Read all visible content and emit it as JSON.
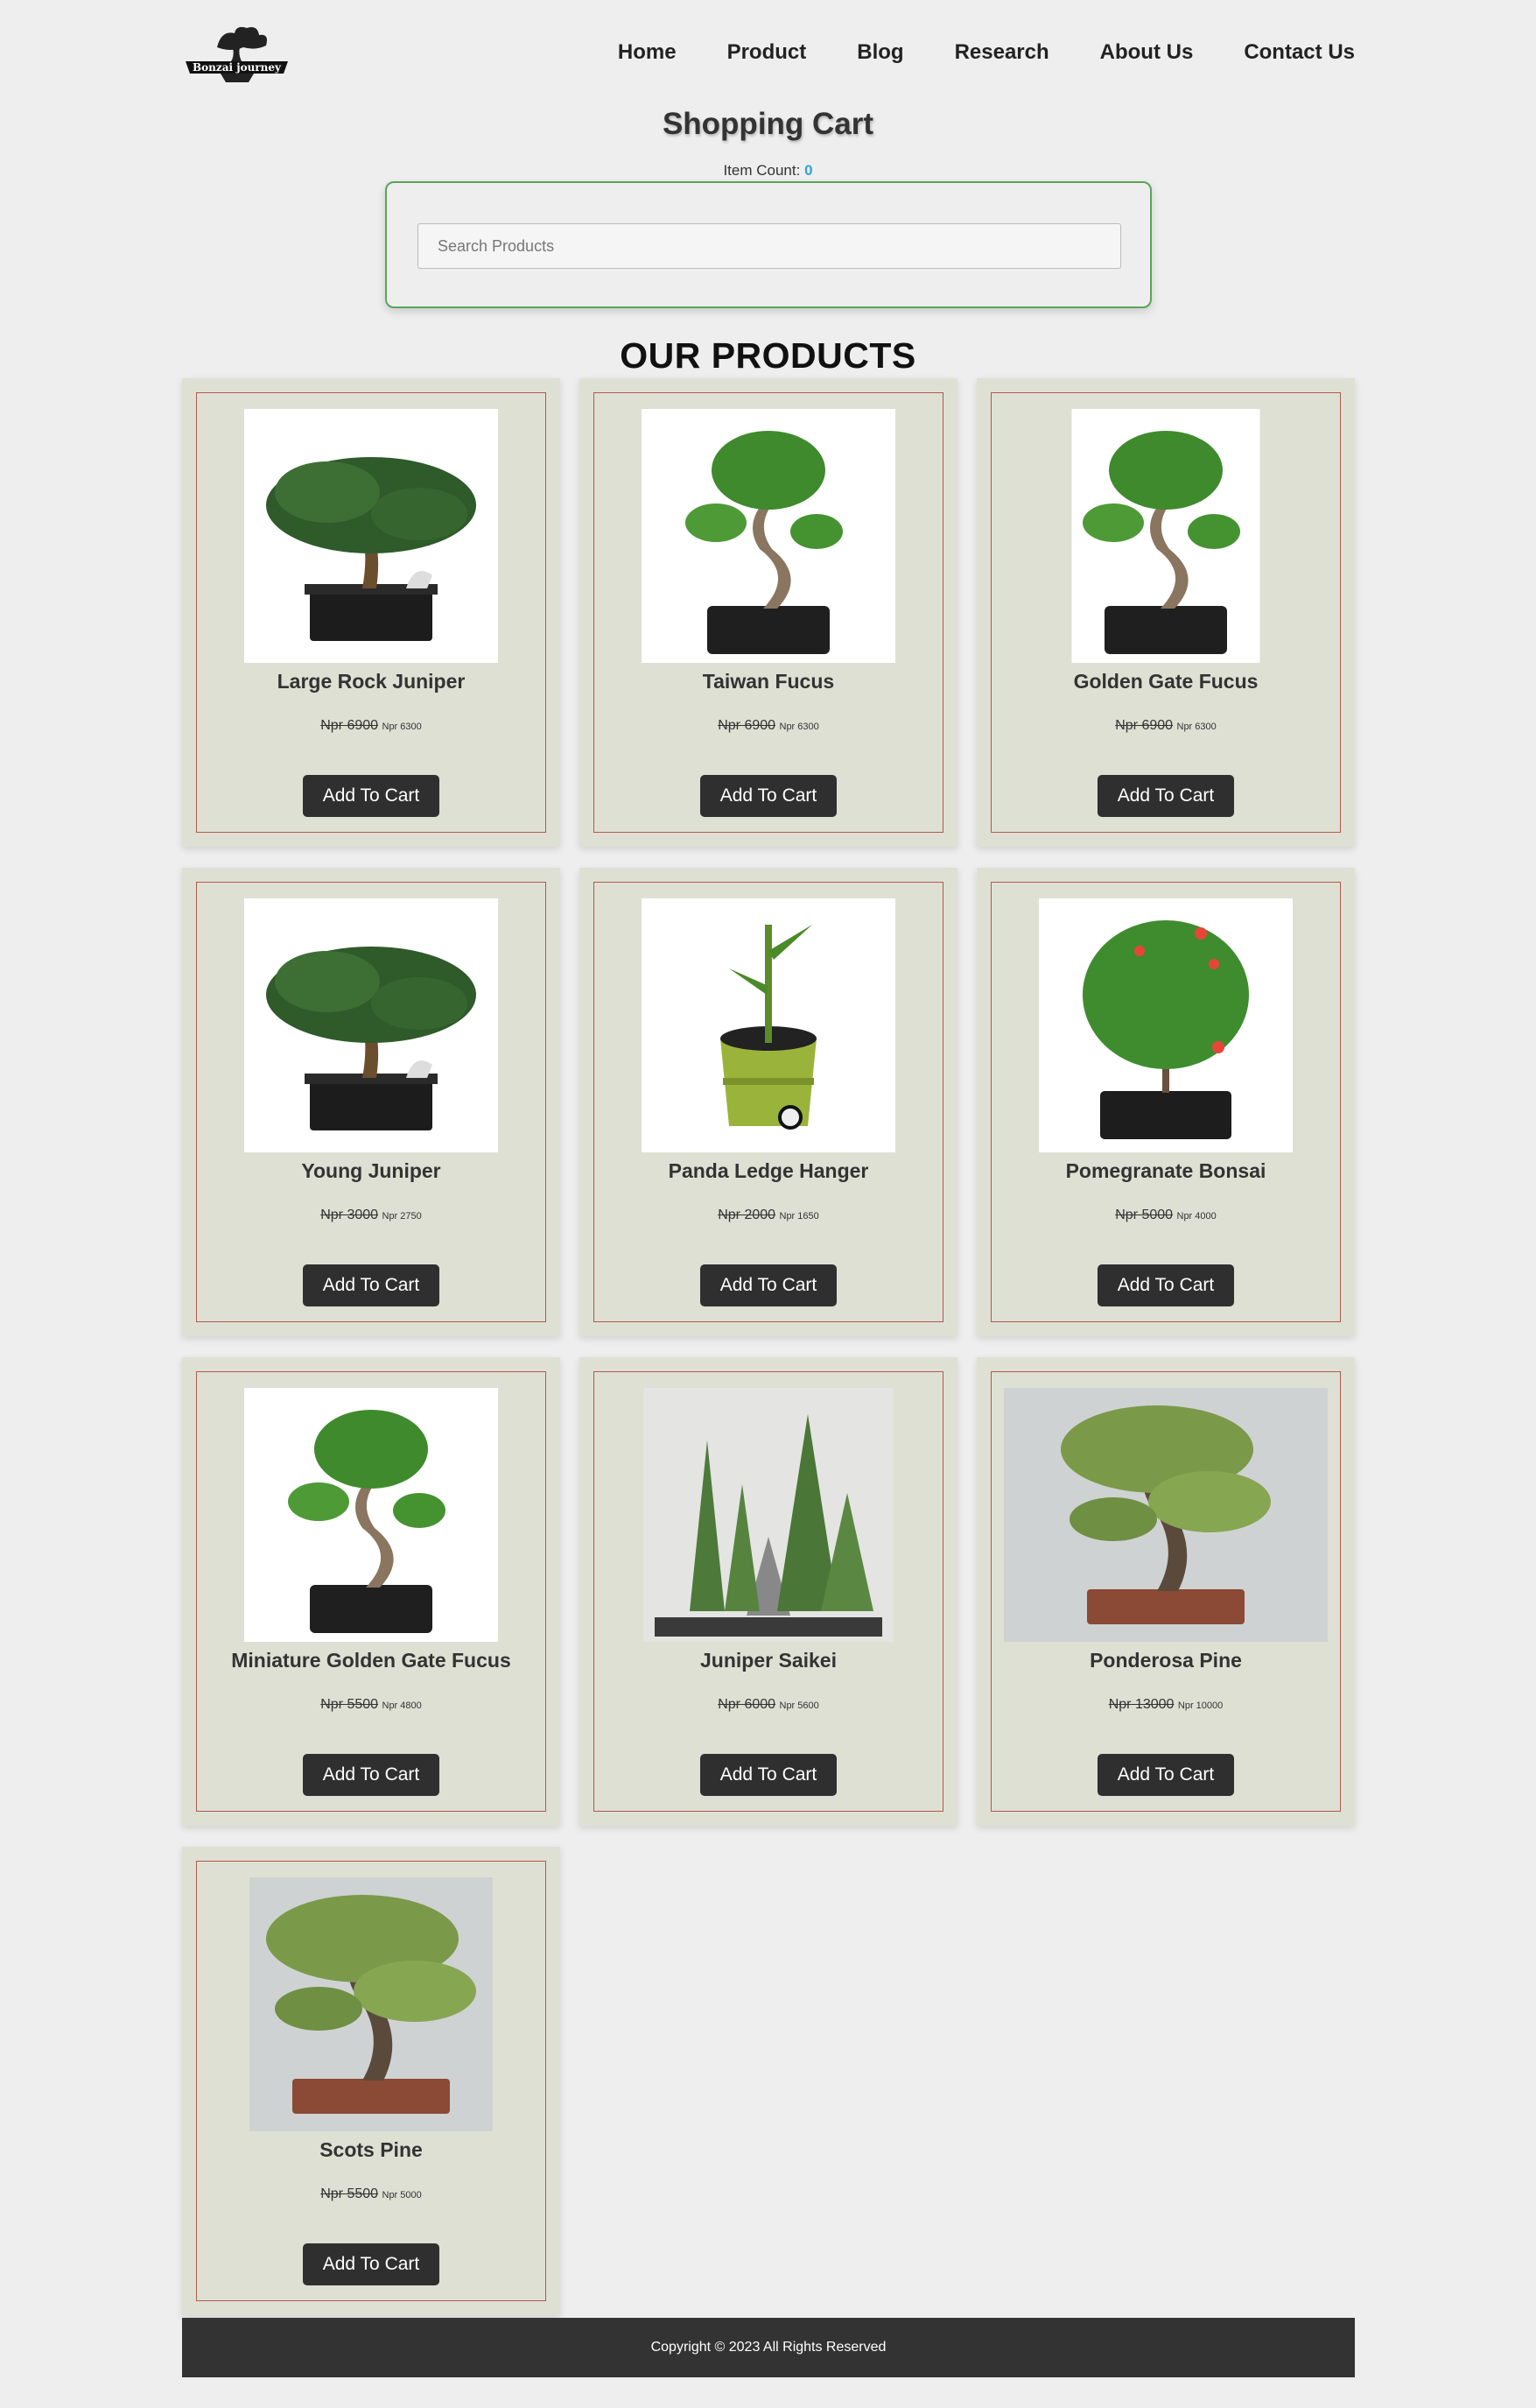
{
  "header": {
    "logo_text": "Bonzai journey",
    "nav": [
      "Home",
      "Product",
      "Blog",
      "Research",
      "About Us",
      "Contact Us"
    ]
  },
  "cart": {
    "title": "Shopping Cart",
    "item_count_label": "Item Count:",
    "item_count": "0"
  },
  "search": {
    "placeholder": "Search Products"
  },
  "products_title": "OUR PRODUCTS",
  "products": [
    {
      "name": "Large Rock Juniper",
      "old_price": "Npr 6900",
      "new_price": "Npr 6300",
      "button": "Add To Cart",
      "icon": "juniper-bonsai-image"
    },
    {
      "name": "Taiwan Fucus",
      "old_price": "Npr 6900",
      "new_price": "Npr 6300",
      "button": "Add To Cart",
      "icon": "ficus-bonsai-image"
    },
    {
      "name": "Golden Gate Fucus",
      "old_price": "Npr 6900",
      "new_price": "Npr 6300",
      "button": "Add To Cart",
      "icon": "ficus-bonsai-image"
    },
    {
      "name": "Young Juniper",
      "old_price": "Npr 3000",
      "new_price": "Npr 2750",
      "button": "Add To Cart",
      "icon": "juniper-bonsai-image"
    },
    {
      "name": "Panda Ledge Hanger",
      "old_price": "Npr 2000",
      "new_price": "Npr 1650",
      "button": "Add To Cart",
      "icon": "bamboo-pot-image"
    },
    {
      "name": "Pomegranate Bonsai",
      "old_price": "Npr 5000",
      "new_price": "Npr 4000",
      "button": "Add To Cart",
      "icon": "pomegranate-bonsai-image"
    },
    {
      "name": "Miniature Golden Gate Fucus",
      "old_price": "Npr 5500",
      "new_price": "Npr 4800",
      "button": "Add To Cart",
      "icon": "ficus-bonsai-image"
    },
    {
      "name": "Juniper Saikei",
      "old_price": "Npr 6000",
      "new_price": "Npr 5600",
      "button": "Add To Cart",
      "icon": "saikei-forest-image"
    },
    {
      "name": "Ponderosa Pine",
      "old_price": "Npr 13000",
      "new_price": "Npr 10000",
      "button": "Add To Cart",
      "icon": "pine-bonsai-image"
    },
    {
      "name": "Scots Pine",
      "old_price": "Npr 5500",
      "new_price": "Npr 5000",
      "button": "Add To Cart",
      "icon": "pine-bonsai-image"
    }
  ],
  "footer": {
    "text": "Copyright © 2023 All Rights Reserved"
  },
  "colors": {
    "card_bg": "#dfe0d4",
    "card_border": "#b05a4a",
    "button_bg": "#2f2f2f",
    "count_accent": "#2fa3d9",
    "search_border": "#5aa55a",
    "footer_bg": "#333333"
  }
}
